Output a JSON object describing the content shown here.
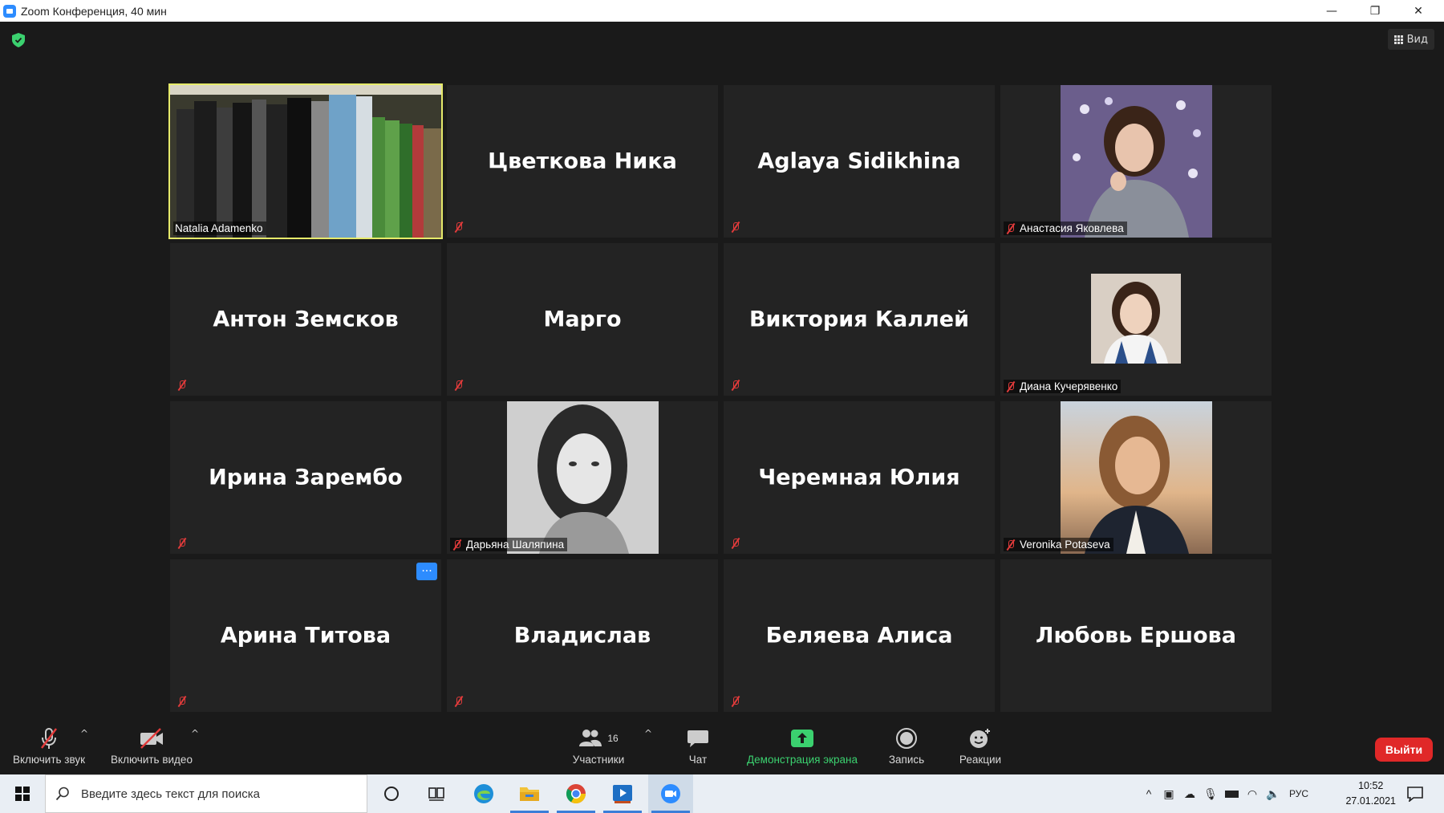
{
  "window": {
    "title": "Zoom Конференция, 40 мин",
    "minimize": "—",
    "restore": "❐",
    "close": "✕"
  },
  "meeting": {
    "view_label": "Вид",
    "security_color": "#3bd16f",
    "active_speaker_border": "#e6ea6a",
    "participants": [
      {
        "name": "Natalia Adamenko",
        "video": true,
        "muted": false,
        "image": "bookshelf"
      },
      {
        "name": "Цветкова Ника",
        "video": false,
        "muted": true
      },
      {
        "name": "Aglaya Sidikhina",
        "video": false,
        "muted": true
      },
      {
        "name": "Анастасия Яковлева",
        "video": true,
        "muted": true,
        "image": "portrait"
      },
      {
        "name": "Антон Земсков",
        "video": false,
        "muted": true
      },
      {
        "name": "Марго",
        "video": false,
        "muted": true
      },
      {
        "name": "Виктория Каллей",
        "video": false,
        "muted": true
      },
      {
        "name": "Диана Кучерявенко",
        "video": true,
        "muted": true,
        "image": "portrait"
      },
      {
        "name": "Ирина Зарембо",
        "video": false,
        "muted": true
      },
      {
        "name": "Дарьяна Шаляпина",
        "video": true,
        "muted": true,
        "image": "portrait-bw"
      },
      {
        "name": "Черемная Юлия",
        "video": false,
        "muted": true
      },
      {
        "name": "Veronika Potaseva",
        "video": true,
        "muted": true,
        "image": "portrait"
      },
      {
        "name": "Арина Титова",
        "video": false,
        "muted": true,
        "more_button": "···"
      },
      {
        "name": "Владислав",
        "video": false,
        "muted": true
      },
      {
        "name": "Беляева Алиса",
        "video": false,
        "muted": true
      },
      {
        "name": "Любовь Ершова",
        "video": false,
        "muted": false
      }
    ]
  },
  "toolbar": {
    "unmute_label": "Включить звук",
    "start_video_label": "Включить видео",
    "participants_label": "Участники",
    "participants_count": "16",
    "chat_label": "Чат",
    "share_label": "Демонстрация экрана",
    "record_label": "Запись",
    "reactions_label": "Реакции",
    "leave_label": "Выйти",
    "leave_color": "#e02828",
    "share_color": "#3bd16f"
  },
  "taskbar": {
    "search_placeholder": "Введите здесь текст для поиска",
    "language": "РУС",
    "time": "10:52",
    "date": "27.01.2021"
  }
}
